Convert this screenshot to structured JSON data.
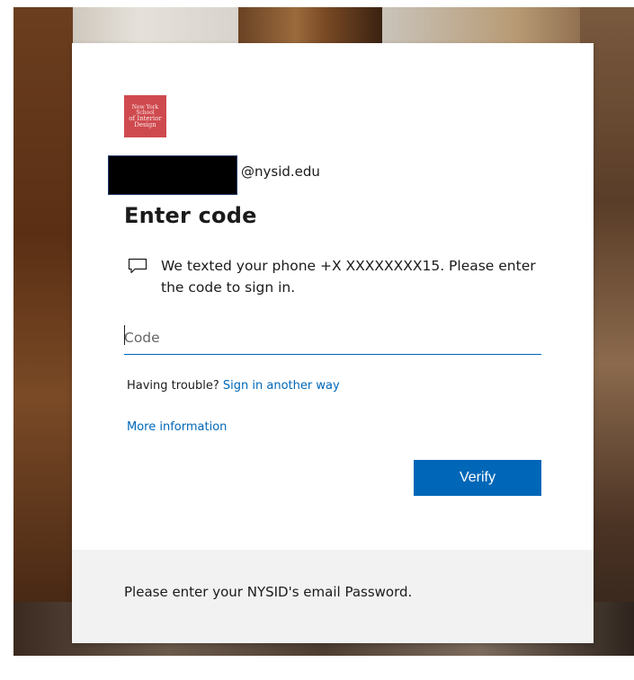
{
  "logo": {
    "lines": [
      "New York",
      "School",
      "of Interior",
      "Design"
    ]
  },
  "identity": {
    "domain": "@nysid.edu"
  },
  "title": "Enter code",
  "message": "We texted your phone +X XXXXXXXX15. Please enter the code to sign in.",
  "code_input": {
    "value": "",
    "placeholder": "Code"
  },
  "trouble": {
    "prefix": "Having trouble?",
    "link": "Sign in another way"
  },
  "more_info": "More information",
  "verify_label": "Verify",
  "footer_text": "Please enter your NYSID's email Password.",
  "colors": {
    "accent": "#0067b8",
    "logo_bg": "#cf4a4f",
    "footer_bg": "#f2f2f2"
  },
  "icons": {
    "message": "chat-bubble-icon"
  }
}
